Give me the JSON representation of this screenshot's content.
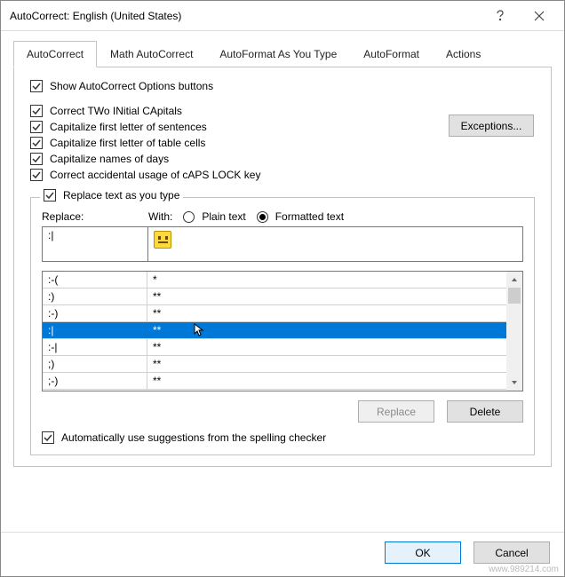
{
  "title": "AutoCorrect: English (United States)",
  "tabs": [
    "AutoCorrect",
    "Math AutoCorrect",
    "AutoFormat As You Type",
    "AutoFormat",
    "Actions"
  ],
  "checks": {
    "show_opts": "Show AutoCorrect Options buttons",
    "two_initial": "Correct TWo INitial CApitals",
    "cap_sent": "Capitalize first letter of sentences",
    "cap_cells": "Capitalize first letter of table cells",
    "cap_days": "Capitalize names of days",
    "caps_lock": "Correct accidental usage of cAPS LOCK key"
  },
  "exceptions": "Exceptions...",
  "replace_as_type": "Replace text as you type",
  "labels": {
    "replace": "Replace:",
    "with": "With:",
    "plain": "Plain text",
    "formatted": "Formatted text"
  },
  "input_replace_value": ":|",
  "list": [
    {
      "a": ":-(",
      "b": "*"
    },
    {
      "a": ":)",
      "b": "**"
    },
    {
      "a": ":-)",
      "b": "**"
    },
    {
      "a": ":|",
      "b": "**"
    },
    {
      "a": ":-|",
      "b": "**"
    },
    {
      "a": ";)",
      "b": "**"
    },
    {
      "a": ";-)",
      "b": "**"
    }
  ],
  "selected_index": 3,
  "actions": {
    "replace": "Replace",
    "delete": "Delete"
  },
  "auto_suggest": "Automatically use suggestions from the spelling checker",
  "footer": {
    "ok": "OK",
    "cancel": "Cancel"
  },
  "watermark": "www.989214.com"
}
